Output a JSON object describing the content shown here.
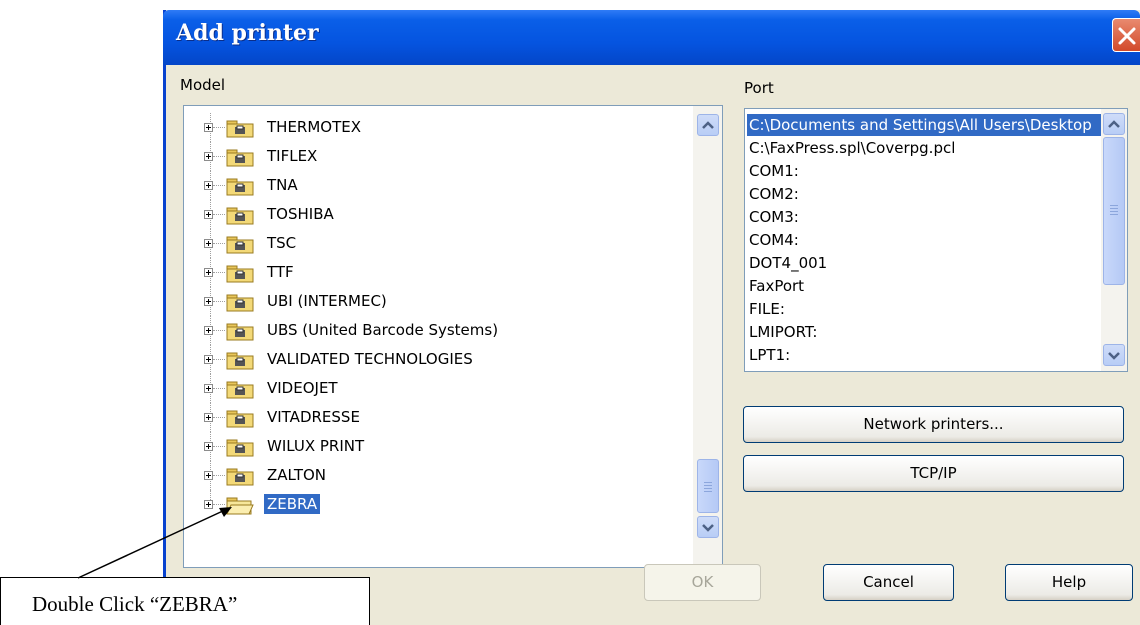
{
  "window": {
    "title": "Add printer"
  },
  "model": {
    "label": "Model",
    "items": [
      {
        "label": "THERMOTEX"
      },
      {
        "label": "TIFLEX"
      },
      {
        "label": "TNA"
      },
      {
        "label": "TOSHIBA"
      },
      {
        "label": "TSC"
      },
      {
        "label": "TTF"
      },
      {
        "label": "UBI (INTERMEC)"
      },
      {
        "label": "UBS (United Barcode Systems)"
      },
      {
        "label": "VALIDATED TECHNOLOGIES"
      },
      {
        "label": "VIDEOJET"
      },
      {
        "label": "VITADRESSE"
      },
      {
        "label": "WILUX PRINT"
      },
      {
        "label": "ZALTON"
      },
      {
        "label": "ZEBRA",
        "selected": true
      }
    ]
  },
  "port": {
    "label": "Port",
    "items": [
      {
        "label": "C:\\Documents and Settings\\All Users\\Desktop",
        "selected": true
      },
      {
        "label": "C:\\FaxPress.spl\\Coverpg.pcl"
      },
      {
        "label": "COM1:"
      },
      {
        "label": "COM2:"
      },
      {
        "label": "COM3:"
      },
      {
        "label": "COM4:"
      },
      {
        "label": "DOT4_001"
      },
      {
        "label": "FaxPort"
      },
      {
        "label": "FILE:"
      },
      {
        "label": "LMIPORT:"
      },
      {
        "label": "LPT1:"
      }
    ]
  },
  "buttons": {
    "network_printers": "Network printers...",
    "tcpip": "TCP/IP",
    "ok": "OK",
    "cancel": "Cancel",
    "help": "Help"
  },
  "annotation": {
    "text": "Double Click “ZEBRA”"
  },
  "colors": {
    "selection": "#316ac5",
    "titlebar": "#0554e0",
    "dialog_bg": "#ece9d8"
  }
}
